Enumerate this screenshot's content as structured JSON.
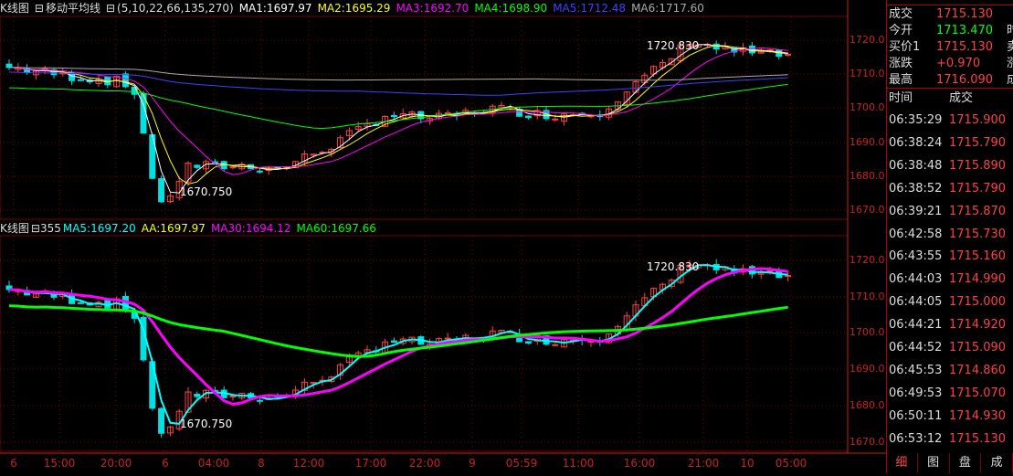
{
  "colors": {
    "up": "#ff4040",
    "down": "#00e0e0",
    "grid": "#7a0000",
    "axis": "#c82020",
    "ma1": "#ffffff",
    "ma2": "#ffff00",
    "ma3": "#ff00ff",
    "ma4": "#00ff00",
    "ma5": "#4040ff",
    "ma6": "#aaaaaa"
  },
  "top_chart": {
    "title": "K线图",
    "indicator": "移动平均线",
    "params": "(5,10,22,66,135,270)",
    "ma": [
      {
        "label": "MA1:1697.97",
        "color": "#ffffff"
      },
      {
        "label": "MA2:1695.29",
        "color": "#ffff00"
      },
      {
        "label": "MA3:1692.70",
        "color": "#ff00ff"
      },
      {
        "label": "MA4:1698.90",
        "color": "#00ff00"
      },
      {
        "label": "MA5:1712.48",
        "color": "#4040ff"
      },
      {
        "label": "MA6:1717.60",
        "color": "#aaaaaa"
      }
    ],
    "y_ticks": [
      "1720.0",
      "1710.0",
      "1700.0",
      "1690.0",
      "1680.0",
      "1670.0"
    ],
    "high_label": "1720.830",
    "low_label": "1670.750"
  },
  "bottom_chart": {
    "title": "K线图",
    "indicator": "355",
    "ma": [
      {
        "label": "MA5:1697.20",
        "color": "#00ffff"
      },
      {
        "label": "AA:1697.97",
        "color": "#ffff00"
      },
      {
        "label": "MA30:1694.12",
        "color": "#ff00ff"
      },
      {
        "label": "MA60:1697.66",
        "color": "#00ff00"
      }
    ],
    "y_ticks": [
      "1720.0",
      "1710.0",
      "1700.0",
      "1690.0",
      "1680.0",
      "1670.0"
    ],
    "high_label": "1720.830",
    "low_label": "1670.750"
  },
  "x_axis": [
    "6",
    "15:00",
    "20:00",
    "6",
    "04:00",
    "8",
    "12:00",
    "17:00",
    "22:00",
    "9",
    "05:59",
    "11:00",
    "16:00",
    "21:00",
    "10",
    "05:00"
  ],
  "quote": [
    {
      "k": "成交",
      "v": "1715.130",
      "color": "#ff4040"
    },
    {
      "k": "今开",
      "v": "1713.470",
      "color": "#00ff00"
    },
    {
      "k": "买价1",
      "v": "1715.130",
      "color": "#ff4040"
    },
    {
      "k": "涨跌",
      "v": "+0.970",
      "color": "#ff4040"
    },
    {
      "k": "最高",
      "v": "1716.090",
      "color": "#ff4040"
    }
  ],
  "quote_cut": [
    "时",
    "卖",
    "涨",
    "成"
  ],
  "ticks_header": {
    "time": "时间",
    "price": "成交"
  },
  "ticks": [
    {
      "t": "06:35:29",
      "p": "1715.900"
    },
    {
      "t": "06:38:24",
      "p": "1715.790"
    },
    {
      "t": "06:38:48",
      "p": "1715.890"
    },
    {
      "t": "06:38:52",
      "p": "1715.790"
    },
    {
      "t": "06:39:21",
      "p": "1715.870"
    },
    {
      "t": "06:42:58",
      "p": "1715.730"
    },
    {
      "t": "06:43:55",
      "p": "1715.160"
    },
    {
      "t": "06:44:03",
      "p": "1714.990"
    },
    {
      "t": "06:44:05",
      "p": "1715.000"
    },
    {
      "t": "06:44:21",
      "p": "1714.920"
    },
    {
      "t": "06:44:52",
      "p": "1715.090"
    },
    {
      "t": "06:45:53",
      "p": "1714.860"
    },
    {
      "t": "06:49:53",
      "p": "1715.070"
    },
    {
      "t": "06:50:11",
      "p": "1714.930"
    },
    {
      "t": "06:53:12",
      "p": "1715.130"
    }
  ],
  "tabs": [
    "细",
    "图",
    "盘",
    "成"
  ]
}
